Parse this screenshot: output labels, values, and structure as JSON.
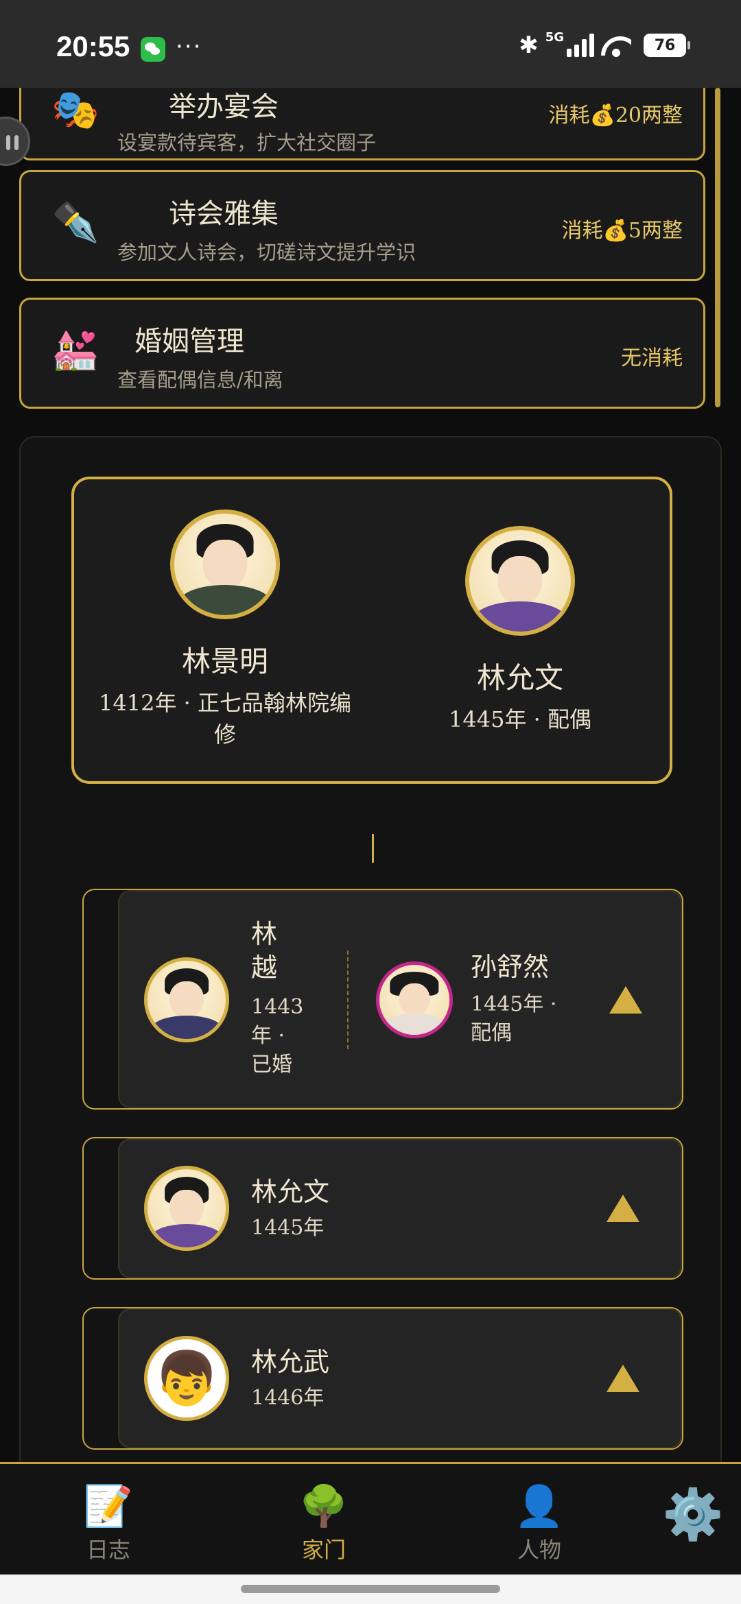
{
  "status_bar": {
    "time": "20:55",
    "more": "···",
    "network": "5G",
    "battery": "76"
  },
  "actions": [
    {
      "icon": "🎭",
      "title": "举办宴会",
      "desc": "设宴款待宾客，扩大社交圈子",
      "cost": "消耗💰20两整"
    },
    {
      "icon": "✒️",
      "title": "诗会雅集",
      "desc": "参加文人诗会，切磋诗文提升学识",
      "cost": "消耗💰5两整"
    },
    {
      "icon": "💒",
      "title": "婚姻管理",
      "desc": "查看配偶信息/和离",
      "cost": "无消耗"
    }
  ],
  "parents": {
    "father": {
      "name": "林景明",
      "info": "1412年 · 正七品翰林院编修"
    },
    "spouse": {
      "name": "林允文",
      "info": "1445年 · 配偶"
    }
  },
  "children": [
    {
      "name": "林越",
      "info": "1443年 · 已婚",
      "spouse_name": "孙舒然",
      "spouse_info": "1445年 · 配偶"
    },
    {
      "name": "林允文",
      "info": "1445年"
    },
    {
      "name": "林允武",
      "info": "1446年",
      "avatar_emoji": "👦"
    }
  ],
  "nav": [
    {
      "icon": "📝",
      "label": "日志"
    },
    {
      "icon": "🌳",
      "label": "家门"
    },
    {
      "icon": "👤",
      "label": "人物"
    },
    {
      "icon": "⚙️",
      "label": ""
    }
  ],
  "colors": {
    "accent": "#d4b044",
    "background": "#0d0d0d",
    "card": "#1a1a1a"
  }
}
